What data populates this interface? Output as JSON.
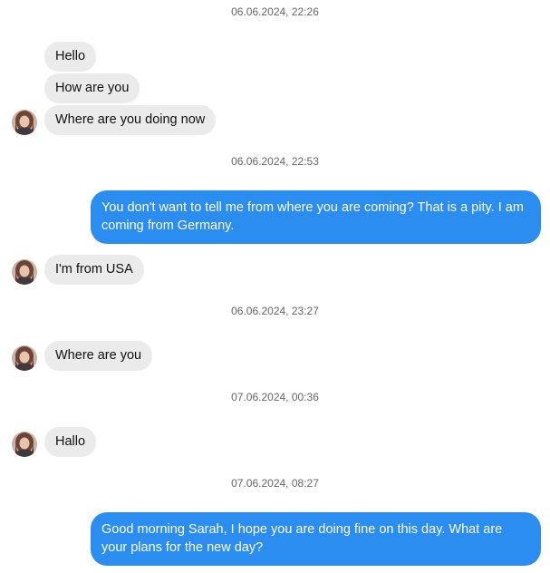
{
  "chat": {
    "timestamps": [
      "06.06.2024, 22:26",
      "06.06.2024, 22:53",
      "06.06.2024, 23:27",
      "07.06.2024, 00:36",
      "07.06.2024, 08:27"
    ],
    "messages": {
      "m1": "Hello",
      "m2": "How are you",
      "m3": "Where are you doing now",
      "m4": "You don't want to tell me from where you are coming? That is a pity. I am coming from Germany.",
      "m5": "I'm from USA",
      "m6": "Where are you",
      "m7": "Hallo",
      "m8": "Good morning Sarah, I hope you are doing fine on this day. What are your plans for the new day?"
    },
    "colors": {
      "incoming_bubble": "#ebebeb",
      "outgoing_bubble": "#2b8def",
      "timestamp_text": "#666666"
    },
    "icons": {
      "contact_avatar": "contact-avatar-photo"
    }
  }
}
